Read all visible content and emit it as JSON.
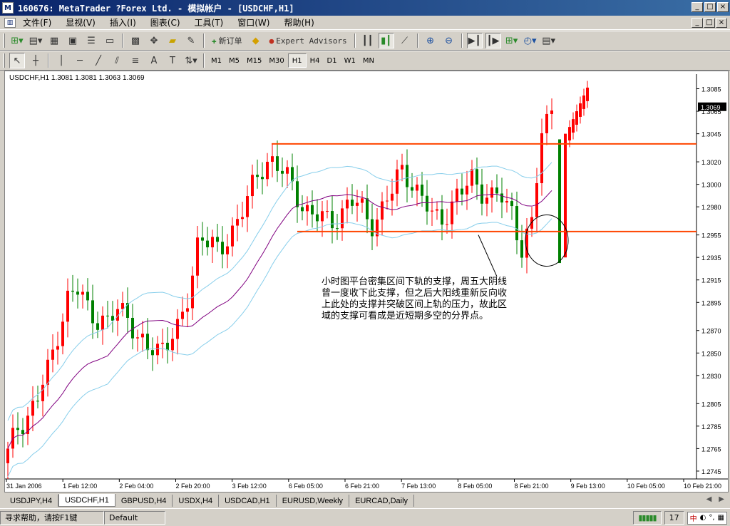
{
  "window": {
    "title": "160676: MetaTrader ?Forex Ltd. - 模拟帐户 - [USDCHF,H1]",
    "btn_min": "_",
    "btn_max": "□",
    "btn_close": "×"
  },
  "menu": {
    "items": [
      "文件(F)",
      "显视(V)",
      "插入(I)",
      "图表(C)",
      "工具(T)",
      "窗口(W)",
      "帮助(H)"
    ]
  },
  "toolbar": {
    "new_order": "新订单",
    "expert_advisors": "Expert Advisors",
    "timeframes": [
      "M1",
      "M5",
      "M15",
      "M30",
      "H1",
      "H4",
      "D1",
      "W1",
      "MN"
    ],
    "active_timeframe": "H1"
  },
  "chart": {
    "symbol_info": "USDCHF,H1  1.3081 1.3081 1.3063 1.3069",
    "current_price": "1.3069",
    "annotation_lines": [
      "小时图平台密集区间下轨的支撑，周五大阴线",
      "曾一度收下此支撑，但之后大阳线重新反向收",
      "上此处的支撑并突破区间上轨的压力，故此区",
      "域的支撑可看成是近短期多空的分界点。"
    ]
  },
  "chart_data": {
    "type": "candlestick",
    "symbol": "USDCHF",
    "timeframe": "H1",
    "y_ticks": [
      "1.3085",
      "1.3065",
      "1.3045",
      "1.3020",
      "1.3000",
      "1.2980",
      "1.2955",
      "1.2935",
      "1.2915",
      "1.2895",
      "1.2870",
      "1.2850",
      "1.2830",
      "1.2805",
      "1.2785",
      "1.2765",
      "1.2745"
    ],
    "ylim": [
      1.2738,
      1.3098
    ],
    "x_ticks": [
      "31 Jan 2006",
      "1 Feb 12:00",
      "2 Feb 04:00",
      "2 Feb 20:00",
      "3 Feb 12:00",
      "6 Feb 05:00",
      "6 Feb 21:00",
      "7 Feb 13:00",
      "8 Feb 05:00",
      "8 Feb 21:00",
      "9 Feb 13:00",
      "10 Feb 05:00",
      "10 Feb 21:00"
    ],
    "support_level": 1.2958,
    "resistance_level": 1.3036,
    "series": [
      {
        "name": "",
        "values": [
          1.276,
          1.2785,
          1.2795,
          1.281,
          1.2835,
          1.287,
          1.29,
          1.2905,
          1.289,
          1.288,
          1.2875,
          1.289,
          1.2885,
          1.286,
          1.285,
          1.2855,
          1.2865,
          1.287,
          1.29,
          1.296,
          1.295,
          1.2935,
          1.2955,
          1.2975,
          1.299,
          1.301,
          1.3025,
          1.3015,
          1.3,
          1.2985,
          1.2975,
          1.297,
          1.2965,
          1.2975,
          1.2985,
          1.298,
          1.2965,
          1.2975,
          1.299,
          1.3015,
          1.3005,
          1.2985,
          1.2975,
          1.297,
          1.298,
          1.299,
          1.301,
          1.2995,
          1.2985,
          1.299,
          1.298,
          1.294,
          1.296,
          1.305,
          1.3069
        ]
      }
    ],
    "colors": {
      "up": "#ff0000",
      "down": "#008000",
      "levels": "#ff4500",
      "band": "#87ceeb",
      "ma": "#800080"
    }
  },
  "tabs": {
    "items": [
      "USDJPY,H4",
      "USDCHF,H1",
      "GBPUSD,H4",
      "USDX,H4",
      "USDCAD,H1",
      "EURUSD,Weekly",
      "EURCAD,Daily"
    ],
    "active": "USDCHF,H1"
  },
  "status": {
    "help": "寻求帮助，请按F1键",
    "profile": "Default",
    "traffic": "17"
  }
}
